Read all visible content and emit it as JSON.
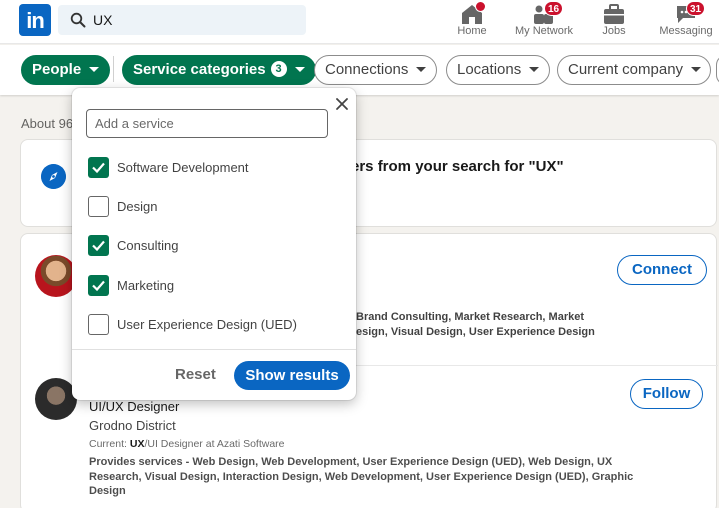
{
  "nav": {
    "logo": "in",
    "search_value": "UX",
    "items": [
      {
        "label": "Home",
        "badge": ""
      },
      {
        "label": "My Network",
        "badge": "16"
      },
      {
        "label": "Jobs",
        "badge": ""
      },
      {
        "label": "Messaging",
        "badge": "31"
      }
    ]
  },
  "filters": {
    "people": "People",
    "service_categories": "Service categories",
    "service_count": "3",
    "connections": "Connections",
    "locations": "Locations",
    "current_company": "Current company"
  },
  "results": {
    "about": "About 96",
    "promo_text": "ers from your search for \"UX\"",
    "person1": {
      "action": "Connect",
      "services": "Brand Consulting, Market Research, Market\nesign, Visual Design, User Experience Design"
    },
    "person2": {
      "title": "UI/UX Designer",
      "location": "Grodno District",
      "current_prefix": "Current: ",
      "current_highlight": "UX",
      "current_rest": "/UI Designer at Azati Software",
      "services": "Provides services - Web Design, Web Development, User Experience Design (UED), Web Design, UX Research, Visual Design, Interaction Design, Web Development, User Experience Design (UED), Graphic Design",
      "action": "Follow"
    }
  },
  "dropdown": {
    "placeholder": "Add a service",
    "options": [
      {
        "label": "Software Development",
        "checked": true
      },
      {
        "label": "Design",
        "checked": false
      },
      {
        "label": "Consulting",
        "checked": true
      },
      {
        "label": "Marketing",
        "checked": true
      },
      {
        "label": "User Experience Design (UED)",
        "checked": false
      }
    ],
    "reset": "Reset",
    "show_results": "Show results"
  },
  "colors": {
    "brand_blue": "#0a66c2",
    "active_green": "#01754f",
    "notification_red": "#cb112d"
  }
}
